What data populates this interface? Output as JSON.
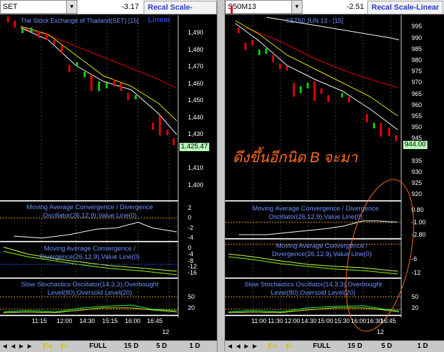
{
  "left": {
    "symbol": "SET",
    "change": "-3.17",
    "recal_label": "Recal Scale-Linear",
    "chart_title": "The Stock Exchange of Thailand(SET) [15]",
    "price_tag": "1,425.47",
    "y_labels": [
      "1,490",
      "1,480",
      "1,470",
      "1,460",
      "1,450",
      "1,440",
      "1,430",
      "1,420",
      "1,410",
      "1,400"
    ],
    "macd1_title": [
      "Moving Average Convergence / Divergence",
      "Oscillator(26,12,9),Value Line(0)"
    ],
    "macd1_labels": [
      "2",
      "0",
      "-2",
      "-4"
    ],
    "macd2_title": [
      "Moving Average Convergence /",
      "Divergence(26,12,9),Value Line(0)"
    ],
    "macd2_labels": [
      "0",
      "-4",
      "-8",
      "-12",
      "-16"
    ],
    "stoch_title": [
      "Slow Stochastics Oscillator(14,3,3),Overbought",
      "Level(80),Oversold Level(20)"
    ],
    "stoch_labels": [
      "50",
      "20"
    ],
    "x_labels": [
      "11:15",
      "12:00",
      "14:30",
      "15:15",
      "16:00",
      "16:45"
    ],
    "day_label": "12"
  },
  "right": {
    "symbol": "S50M13",
    "change": "-2.51",
    "recal_label": "Recal Scale-Linear",
    "chart_title": "SET50 JUN 13 - [15]",
    "price_tag": "944.00",
    "y_labels": [
      "995",
      "990",
      "985",
      "980",
      "975",
      "970",
      "965",
      "960",
      "955",
      "950",
      "945",
      "940",
      "935",
      "930",
      "925",
      "920"
    ],
    "macd1_title": [
      "Moving Average Convergence / Divergence",
      "Oscillator(26,12,9),Value Line(0)"
    ],
    "macd1_labels": [
      "0.80",
      "-1.00",
      "-2.80"
    ],
    "macd2_title": [
      "Moving Average Convergence /",
      "Divergence(26,12,9),Value Line(0)"
    ],
    "macd2_labels": [
      "-6",
      "-12"
    ],
    "stoch_title": [
      "Slow Stochastics Oscillator(14,3,3),Overbought",
      "Level(80),Oversold Level(20)"
    ],
    "stoch_labels": [
      "50",
      "20"
    ],
    "x_labels": [
      "11:00",
      "11:30",
      "12:00",
      "14:30",
      "15:00",
      "15:30",
      "16:00",
      "16:30",
      "16:45"
    ],
    "day_label": "12"
  },
  "annotation": "ดึงขึ้นอีกนิด B จะมา",
  "tabs": {
    "f_plus": "F+",
    "f_minus": "F-",
    "full": "FULL",
    "d15": "15 D",
    "d5": "5 D",
    "d1": "1 D"
  },
  "colors": {
    "bull_candle": "#00cc00",
    "bear_candle": "#dd0000",
    "ma_fast": "#ffffff",
    "ma_mid": "#e8e800",
    "ma_slow": "#dd0000",
    "annotation": "#ff6a1a",
    "price_tag_bg": "#b8ffb8"
  }
}
